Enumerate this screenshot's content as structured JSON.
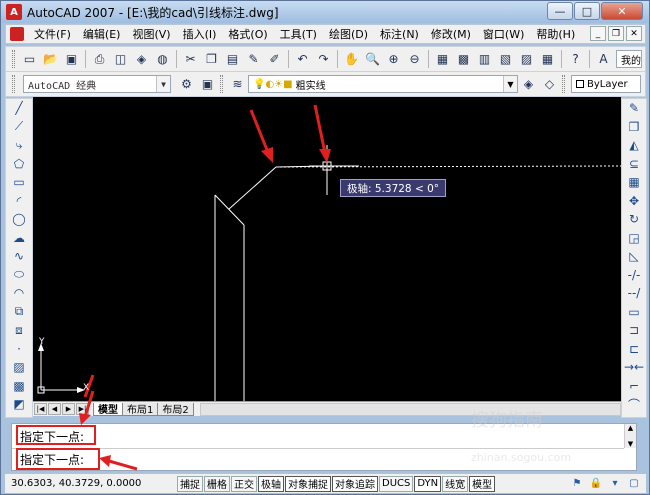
{
  "window": {
    "title": "AutoCAD 2007 - [E:\\我的cad\\引线标注.dwg]",
    "minimize": "—",
    "maximize": "□",
    "close": "✕"
  },
  "menubar": {
    "items": [
      "文件(F)",
      "编辑(E)",
      "视图(V)",
      "插入(I)",
      "格式(O)",
      "工具(T)",
      "绘图(D)",
      "标注(N)",
      "修改(M)",
      "窗口(W)",
      "帮助(H)"
    ],
    "mdi_min": "_",
    "mdi_restore": "❐",
    "mdi_close": "✕"
  },
  "toolbar1": {
    "right_label": "我的"
  },
  "toolbar2": {
    "style_combo": "AutoCAD 经典",
    "layer_combo": "粗实线",
    "color_combo": "ByLayer"
  },
  "canvas": {
    "tooltip": "极轴: 5.3728 < 0°",
    "ucs_x": "X",
    "ucs_y": "Y"
  },
  "tabs": {
    "items": [
      "模型",
      "布局1",
      "布局2"
    ]
  },
  "command": {
    "line1": "指定下一点:",
    "line2": "指定下一点:"
  },
  "status": {
    "coords": "30.6303, 40.3729, 0.0000",
    "buttons": [
      "捕捉",
      "栅格",
      "正交",
      "极轴",
      "对象捕捉",
      "对象追踪",
      "DUCS",
      "DYN",
      "线宽",
      "模型"
    ]
  },
  "watermark": {
    "text": "搜狗指南",
    "url": "zhinan.sogou.com"
  },
  "colors": {
    "canvas_bg": "#000000",
    "arrow_red": "#e02020",
    "tooltip_bg": "#3a3a6e"
  }
}
